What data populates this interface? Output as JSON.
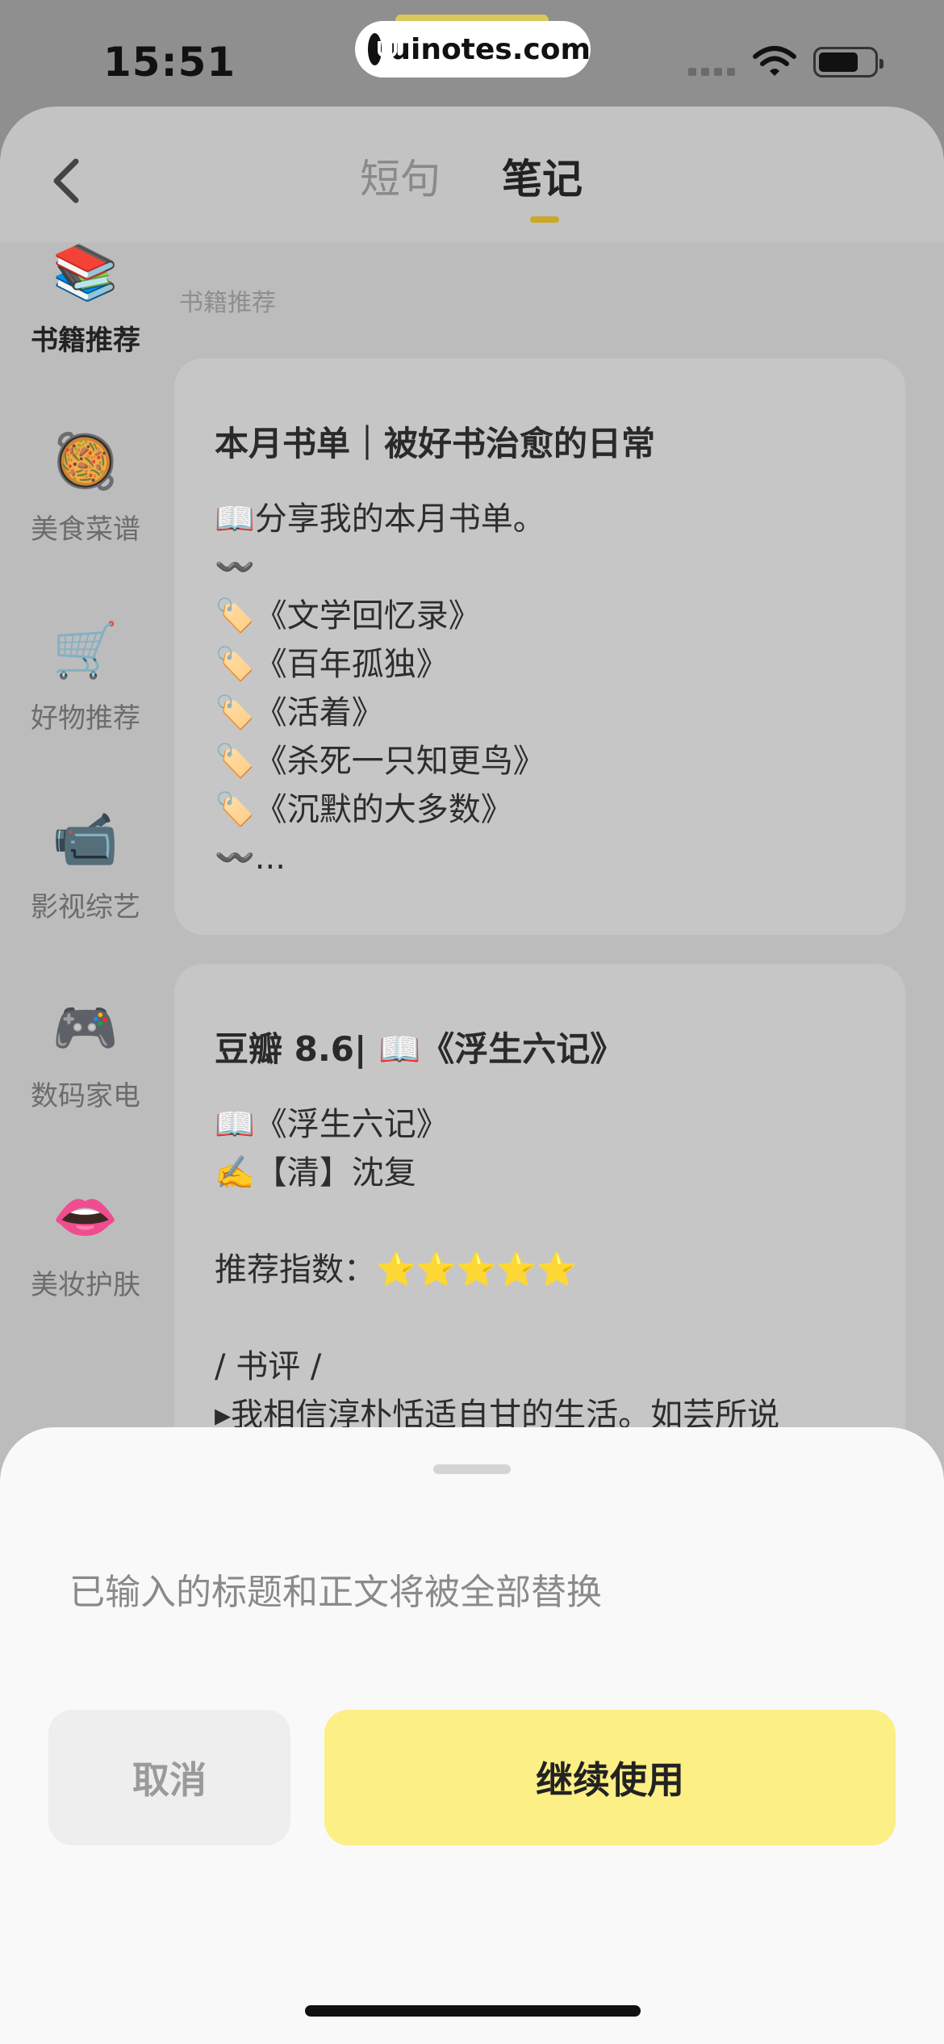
{
  "status_bar": {
    "time": "15:51",
    "watermark": "uinotes.com"
  },
  "header": {
    "tabs": [
      {
        "label": "短句",
        "active": false
      },
      {
        "label": "笔记",
        "active": true
      }
    ]
  },
  "sidebar": {
    "items": [
      {
        "emoji": "📚",
        "label": "书籍推荐",
        "active": true
      },
      {
        "emoji": "🥘",
        "label": "美食菜谱",
        "active": false
      },
      {
        "emoji": "🛒",
        "label": "好物推荐",
        "active": false
      },
      {
        "emoji": "📹",
        "label": "影视综艺",
        "active": false
      },
      {
        "emoji": "🎮",
        "label": "数码家电",
        "active": false
      },
      {
        "emoji": "👄",
        "label": "美妆护肤",
        "active": false
      }
    ]
  },
  "main": {
    "section_label": "书籍推荐",
    "cards": [
      {
        "title": "本月书单｜被好书治愈的日常",
        "lines": [
          "📖分享我的本月书单。",
          "〰️",
          "🏷️《文学回忆录》",
          "🏷️《百年孤独》",
          "🏷️《活着》",
          "🏷️《杀死一只知更鸟》",
          "🏷️《沉默的大多数》",
          "〰️..."
        ]
      },
      {
        "title": "豆瓣 8.6| 📖《浮生六记》",
        "lines": [
          "📖《浮生六记》",
          "✍️【清】沈复",
          "",
          "推荐指数：⭐⭐⭐⭐⭐",
          "",
          "/ 书评 /",
          "▸我相信淳朴恬适自甘的生活。如芸所说"
        ]
      }
    ]
  },
  "dialog": {
    "message": "已输入的标题和正文将被全部替换",
    "cancel_label": "取消",
    "continue_label": "继续使用"
  }
}
